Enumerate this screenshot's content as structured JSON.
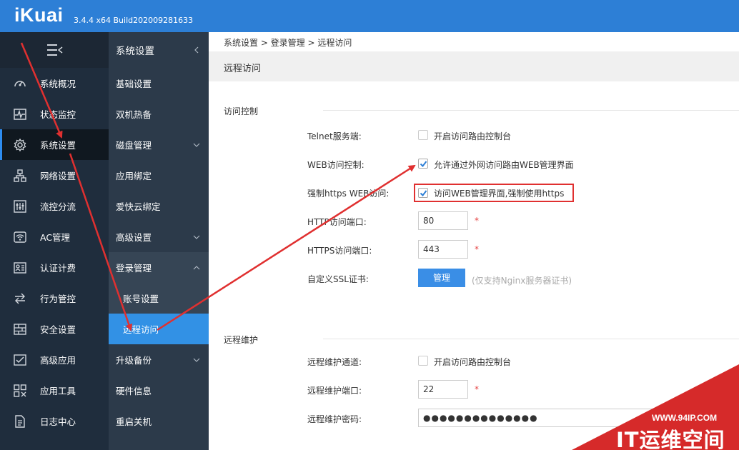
{
  "header": {
    "logo": "iKuai",
    "version": "3.4.4 x64 Build202009281633"
  },
  "sidebar": {
    "items": [
      {
        "label": "系统概况",
        "icon": "dashboard-icon"
      },
      {
        "label": "状态监控",
        "icon": "pulse-icon"
      },
      {
        "label": "系统设置",
        "icon": "gear-icon",
        "active": true
      },
      {
        "label": "网络设置",
        "icon": "network-icon"
      },
      {
        "label": "流控分流",
        "icon": "sliders-icon"
      },
      {
        "label": "AC管理",
        "icon": "wifi-icon"
      },
      {
        "label": "认证计费",
        "icon": "id-card-icon"
      },
      {
        "label": "行为管控",
        "icon": "swap-icon"
      },
      {
        "label": "安全设置",
        "icon": "firewall-icon"
      },
      {
        "label": "高级应用",
        "icon": "checklist-icon"
      },
      {
        "label": "应用工具",
        "icon": "tools-icon"
      },
      {
        "label": "日志中心",
        "icon": "document-icon"
      }
    ]
  },
  "submenu": {
    "title": "系统设置",
    "items": [
      {
        "label": "基础设置"
      },
      {
        "label": "双机热备"
      },
      {
        "label": "磁盘管理",
        "chevron": "down"
      },
      {
        "label": "应用绑定"
      },
      {
        "label": "爱快云绑定"
      },
      {
        "label": "高级设置",
        "chevron": "down"
      },
      {
        "label": "登录管理",
        "chevron": "up",
        "open": true
      },
      {
        "label": "账号设置",
        "child": true
      },
      {
        "label": "远程访问",
        "child": true,
        "selected": true
      },
      {
        "label": "升级备份",
        "chevron": "down"
      },
      {
        "label": "硬件信息"
      },
      {
        "label": "重启关机"
      }
    ]
  },
  "main": {
    "breadcrumb": "系统设置 > 登录管理 > 远程访问",
    "title": "远程访问",
    "access_control": {
      "section": "访问控制",
      "telnet_label": "Telnet服务端:",
      "telnet_text": "开启访问路由控制台",
      "web_label": "WEB访问控制:",
      "web_text": "允许通过外网访问路由WEB管理界面",
      "https_label": "强制https WEB访问:",
      "https_text": "访问WEB管理界面,强制使用https",
      "http_port_label": "HTTP访问端口:",
      "http_port_value": "80",
      "https_port_label": "HTTPS访问端口:",
      "https_port_value": "443",
      "ssl_label": "自定义SSL证书:",
      "ssl_button": "管理",
      "ssl_hint": "(仅支持Nginx服务器证书)",
      "required_mark": "*"
    },
    "remote": {
      "section": "远程维护",
      "channel_label": "远程维护通道:",
      "channel_text": "开启访问路由控制台",
      "port_label": "远程维护端口:",
      "port_value": "22",
      "password_label": "远程维护密码:",
      "password_value": "●●●●●●●●●●●●●●"
    }
  },
  "watermark": {
    "url": "WWW.94IP.COM",
    "name": "IT运维空间"
  },
  "colors": {
    "header": "#2d7fd6",
    "sidebar": "#1f2d3d",
    "submenu": "#2c3a4a",
    "selected": "#3291e5",
    "button": "#3a8ee6",
    "annotation": "#e03030"
  }
}
